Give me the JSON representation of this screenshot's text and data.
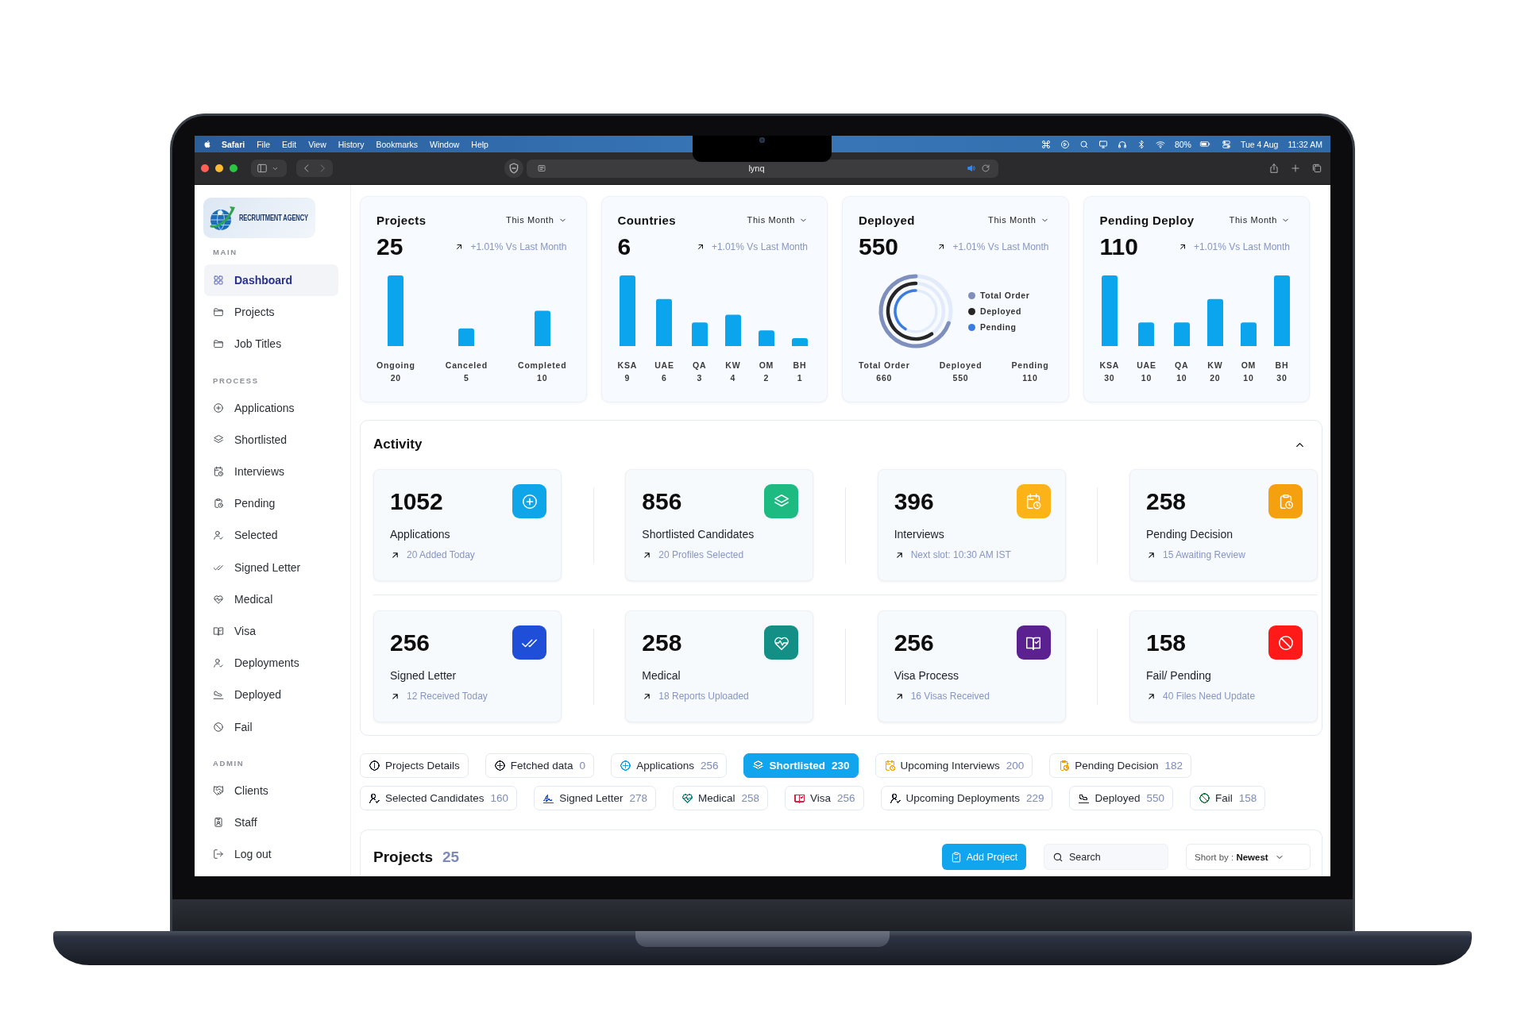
{
  "menu_bar": {
    "app_name": "Safari",
    "menus": [
      "File",
      "Edit",
      "View",
      "History",
      "Bookmarks",
      "Window",
      "Help"
    ],
    "battery": "80%",
    "date": "Tue 4 Aug",
    "time": "11:32 AM"
  },
  "browser": {
    "address": "lynq"
  },
  "sidebar": {
    "logo_text": "RECRUITMENT AGENCY",
    "sections": [
      {
        "title": "MAIN",
        "items": [
          {
            "label": "Dashboard",
            "selected": true
          },
          {
            "label": "Projects",
            "selected": false
          },
          {
            "label": "Job Titles",
            "selected": false
          }
        ]
      },
      {
        "title": "PROCESS",
        "items": [
          {
            "label": "Applications",
            "selected": false
          },
          {
            "label": "Shortlisted",
            "selected": false
          },
          {
            "label": "Interviews",
            "selected": false
          },
          {
            "label": "Pending",
            "selected": false
          },
          {
            "label": "Selected",
            "selected": false
          },
          {
            "label": "Signed Letter",
            "selected": false
          },
          {
            "label": "Medical",
            "selected": false
          },
          {
            "label": "Visa",
            "selected": false
          },
          {
            "label": "Deployments",
            "selected": false
          },
          {
            "label": "Deployed",
            "selected": false
          },
          {
            "label": "Fail",
            "selected": false
          }
        ]
      },
      {
        "title": "ADMIN",
        "items": [
          {
            "label": "Clients",
            "selected": false
          },
          {
            "label": "Staff",
            "selected": false
          },
          {
            "label": "Log out",
            "selected": false
          }
        ]
      }
    ]
  },
  "stat_cards": [
    {
      "title": "Projects",
      "period": "This Month",
      "value": "25",
      "trend": "+1.01% Vs Last Month",
      "chart_data": {
        "type": "bar",
        "categories": [
          "Ongoing",
          "Canceled",
          "Completed"
        ],
        "values": [
          20,
          5,
          10
        ],
        "value_labels": [
          "20",
          "5",
          "10"
        ]
      }
    },
    {
      "title": "Countries",
      "period": "This Month",
      "value": "6",
      "trend": "+1.01% Vs Last Month",
      "chart_data": {
        "type": "bar",
        "categories": [
          "KSA",
          "UAE",
          "QA",
          "KW",
          "OM",
          "BH"
        ],
        "values": [
          9,
          6,
          3,
          4,
          2,
          1
        ],
        "value_labels": [
          "9",
          "6",
          "3",
          "4",
          "2",
          "1"
        ]
      }
    },
    {
      "title": "Deployed",
      "period": "This Month",
      "value": "550",
      "trend": "+1.01% Vs Last Month",
      "legend": [
        {
          "label": "Total Order",
          "color": "#7f8fbd"
        },
        {
          "label": "Deployed",
          "color": "#262626"
        },
        {
          "label": "Pending",
          "color": "#3b7ddf"
        }
      ],
      "totals": [
        {
          "label": "Total Order",
          "value": "660"
        },
        {
          "label": "Deployed",
          "value": "550"
        },
        {
          "label": "Pending",
          "value": "110"
        }
      ]
    },
    {
      "title": "Pending Deploy",
      "period": "This Month",
      "value": "110",
      "trend": "+1.01% Vs Last Month",
      "chart_data": {
        "type": "bar",
        "categories": [
          "KSA",
          "UAE",
          "QA",
          "KW",
          "OM",
          "BH"
        ],
        "values": [
          30,
          10,
          10,
          20,
          10,
          30
        ],
        "value_labels": [
          "30",
          "10",
          "10",
          "20",
          "10",
          "30"
        ]
      }
    }
  ],
  "activity": {
    "title": "Activity",
    "expanded": true,
    "cards": [
      {
        "value": "1052",
        "label": "Applications",
        "note": "20 Added Today",
        "color": "#0ea5e9"
      },
      {
        "value": "856",
        "label": "Shortlisted Candidates",
        "note": "20 Profiles Selected",
        "color": "#1dbb82"
      },
      {
        "value": "396",
        "label": "Interviews",
        "note": "Next slot: 10:30 AM IST",
        "color": "#fbb318"
      },
      {
        "value": "258",
        "label": "Pending Decision",
        "note": "15 Awaiting Review",
        "color": "#f5a00f"
      },
      {
        "value": "256",
        "label": "Signed Letter",
        "note": "12 Received Today",
        "color": "#1f4fd8"
      },
      {
        "value": "258",
        "label": "Medical",
        "note": "18 Reports Uploaded",
        "color": "#138f85"
      },
      {
        "value": "256",
        "label": "Visa Process",
        "note": "16 Visas Received",
        "color": "#5b2190"
      },
      {
        "value": "158",
        "label": "Fail/ Pending",
        "note": "40 Files Need Update",
        "color": "#ff1a1a"
      }
    ]
  },
  "filter_rows": [
    {
      "chips": [
        {
          "label": "Projects Details",
          "selected": false,
          "color": "#1f2430"
        },
        {
          "label": "Fetched data",
          "count": "0",
          "selected": false,
          "color": "#1f2430"
        },
        {
          "label": "Applications",
          "count": "256",
          "selected": false,
          "color": "#0ea5e9"
        },
        {
          "label": "Shortlisted",
          "count": "230",
          "selected": true,
          "color": "#ffffff"
        },
        {
          "label": "Upcoming Interviews",
          "count": "200",
          "selected": false,
          "color": "#f5a623"
        },
        {
          "label": "Pending Decision",
          "count": "182",
          "selected": false,
          "color": "#f59e0b"
        }
      ]
    },
    {
      "chips": [
        {
          "label": "Selected Candidates",
          "count": "160",
          "selected": false,
          "color": "#1f2430"
        },
        {
          "label": "Signed Letter",
          "count": "278",
          "selected": false,
          "color": "#1d4ed8"
        },
        {
          "label": "Medical",
          "count": "258",
          "selected": false,
          "color": "#0d9488"
        },
        {
          "label": "Visa",
          "count": "256",
          "selected": false,
          "color": "#e11d48"
        },
        {
          "label": "Upcoming Deployments",
          "count": "229",
          "selected": false,
          "color": "#1f2430"
        },
        {
          "label": "Deployed",
          "count": "550",
          "selected": false,
          "color": "#1f2430"
        },
        {
          "label": "Fail",
          "count": "158",
          "selected": false,
          "color": "#15803d"
        }
      ]
    }
  ],
  "projects": {
    "title": "Projects",
    "count": "25",
    "add_button": "Add Project",
    "search": {
      "placeholder": "Search"
    },
    "sort": {
      "label": "Short by :",
      "value": "Newest"
    }
  }
}
